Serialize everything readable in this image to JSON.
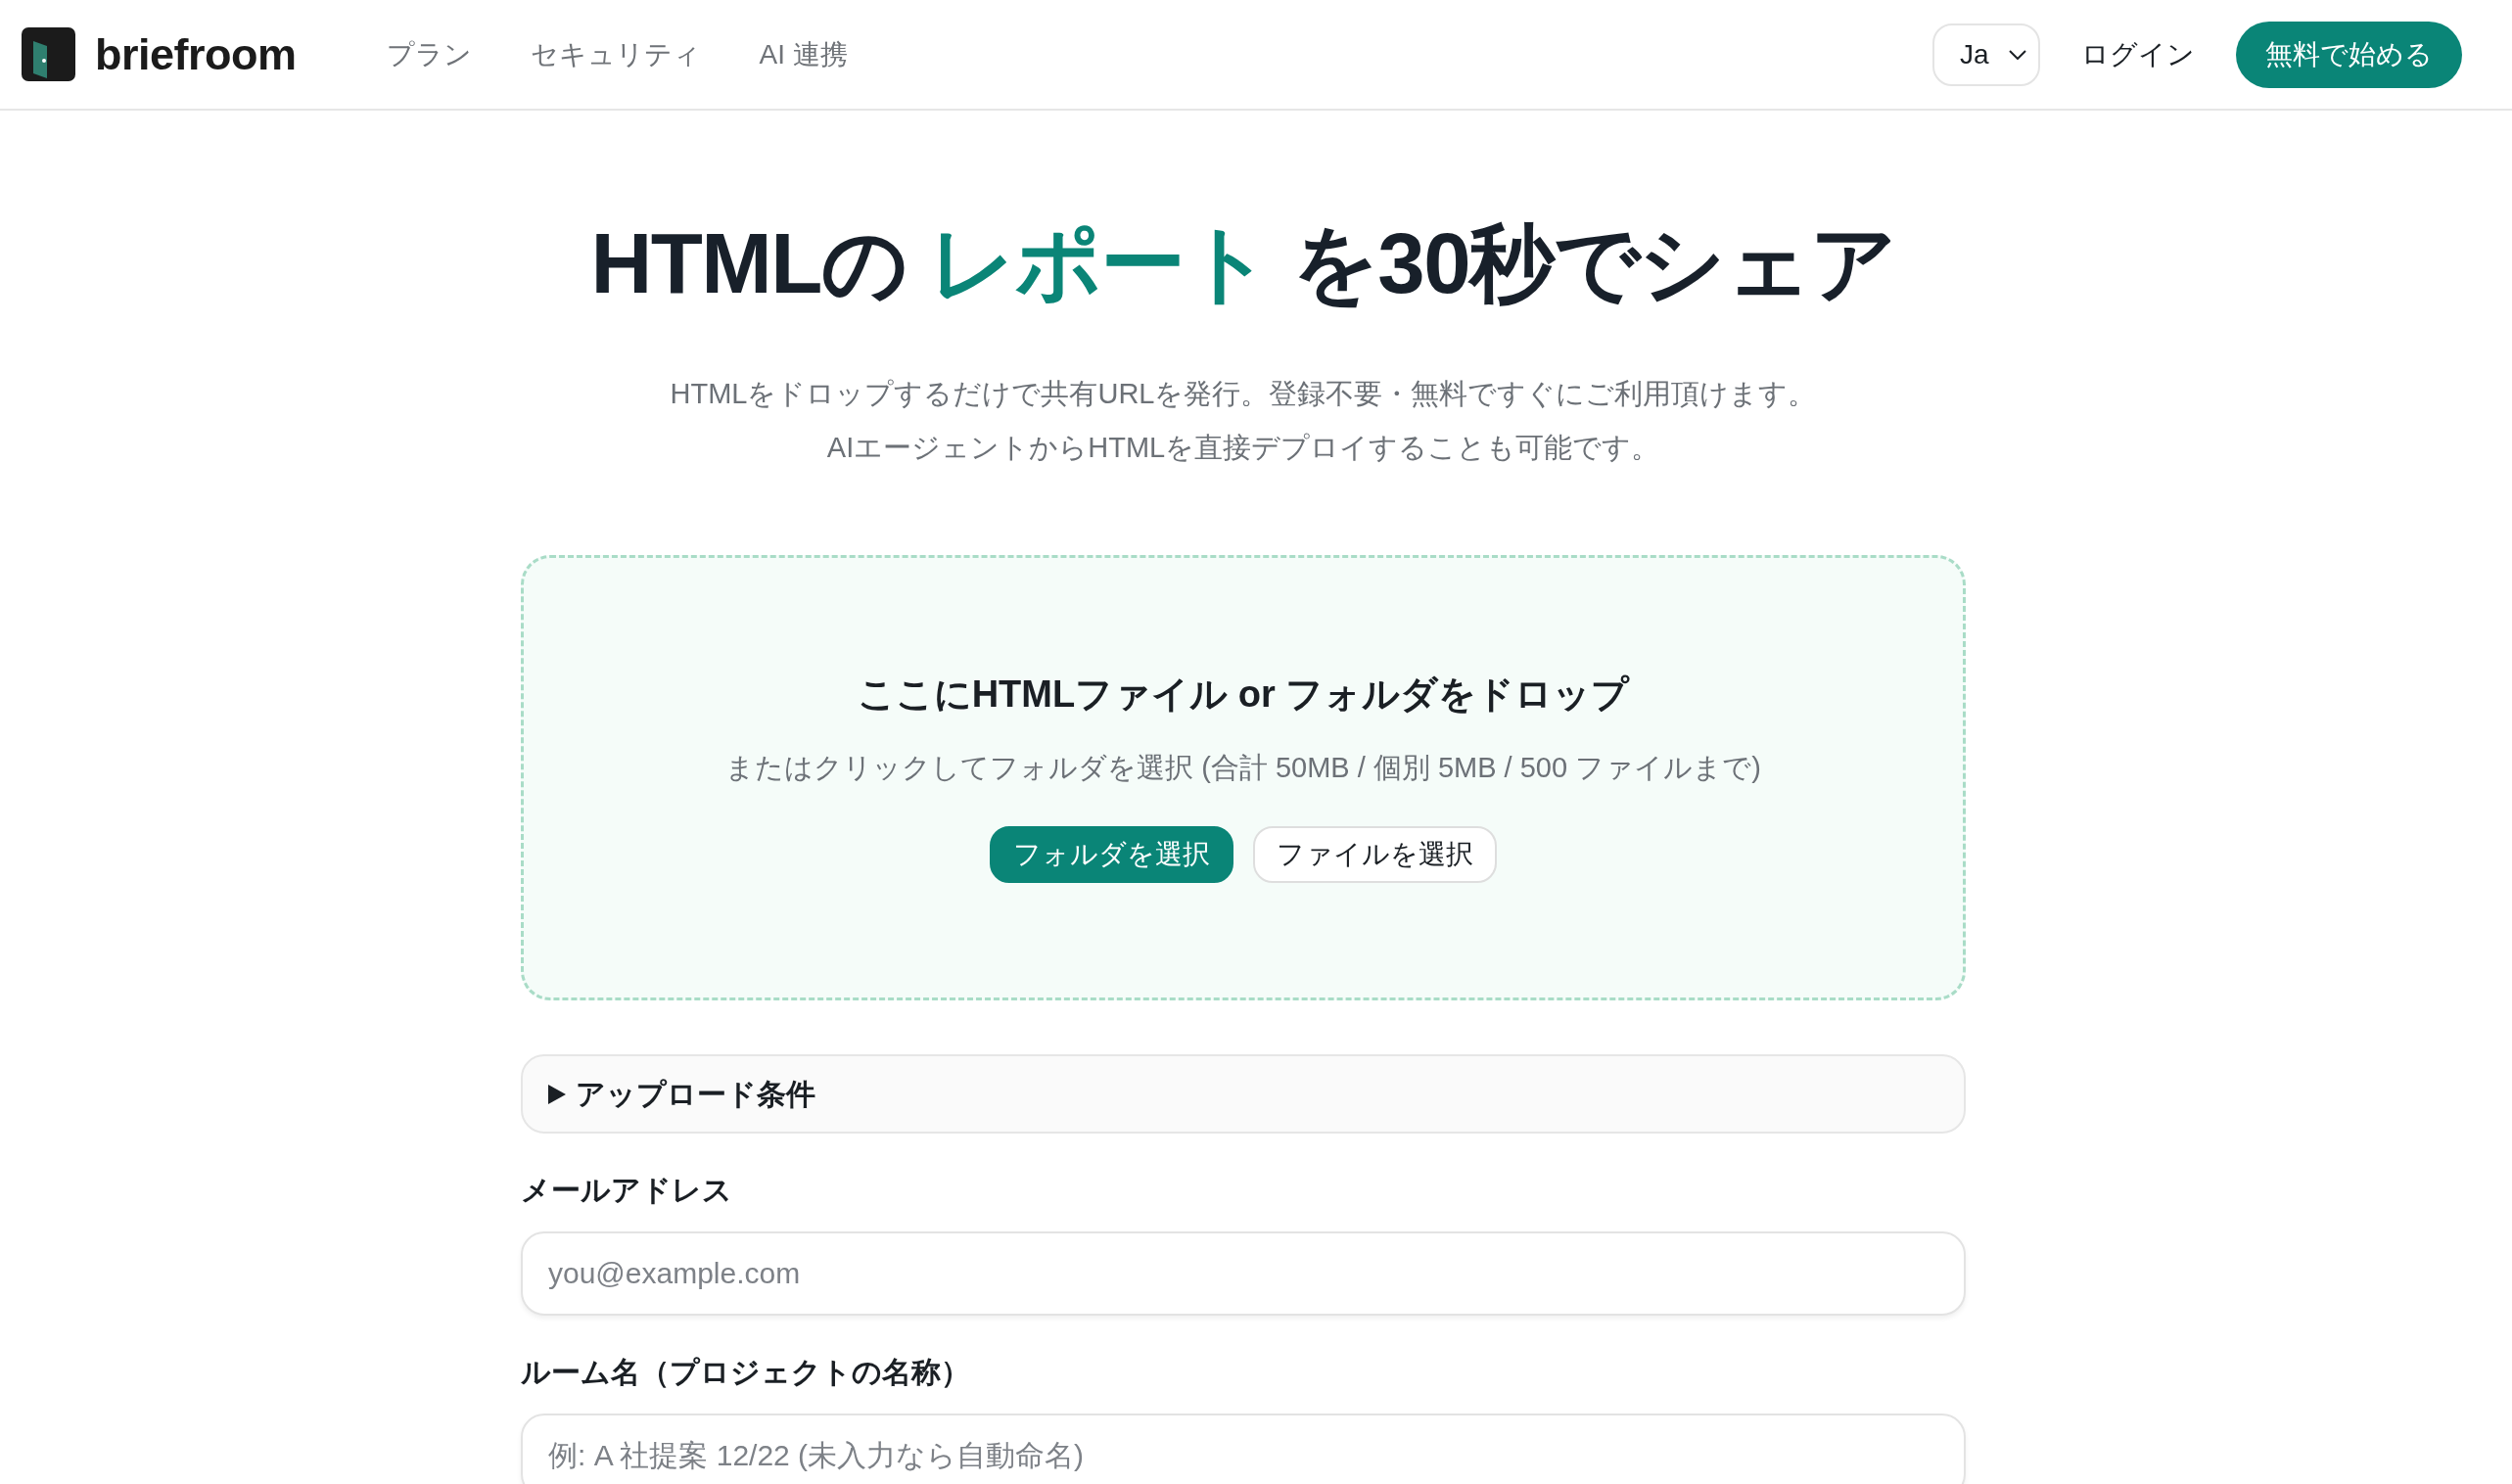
{
  "header": {
    "brand": "briefroom",
    "nav": [
      {
        "label": "プラン"
      },
      {
        "label": "セキュリティ"
      },
      {
        "label": "AI 連携"
      }
    ],
    "language": {
      "value": "Ja"
    },
    "login": "ログイン",
    "cta": "無料で始める"
  },
  "hero": {
    "title_parts": [
      {
        "text": "HTMLの ",
        "accent": false
      },
      {
        "text": "レポート",
        "accent": true
      },
      {
        "text": " を30秒でシェア",
        "accent": false
      }
    ],
    "subtitle_lines": [
      "HTMLをドロップするだけで共有URLを発行。登録不要・無料ですぐにご利用頂けます。",
      "AIエージェントからHTMLを直接デプロイすることも可能です。"
    ]
  },
  "drop_zone": {
    "title": "ここにHTMLファイル or フォルダをドロップ",
    "hint": "またはクリックしてフォルダを選択 (合計 50MB / 個別 5MB / 500 ファイルまで)",
    "buttons": [
      {
        "label": "フォルダを選択",
        "kind": "primary"
      },
      {
        "label": "ファイルを選択",
        "kind": "outline"
      }
    ]
  },
  "upload_conditions": {
    "summary": "アップロード条件",
    "expanded": false
  },
  "fields": [
    {
      "label": "メールアドレス",
      "placeholder": "you@example.com"
    },
    {
      "label": "ルーム名（プロジェクトの名称）",
      "placeholder": "例: A 社提案 12/22 (未入力なら自動命名)"
    }
  ]
}
